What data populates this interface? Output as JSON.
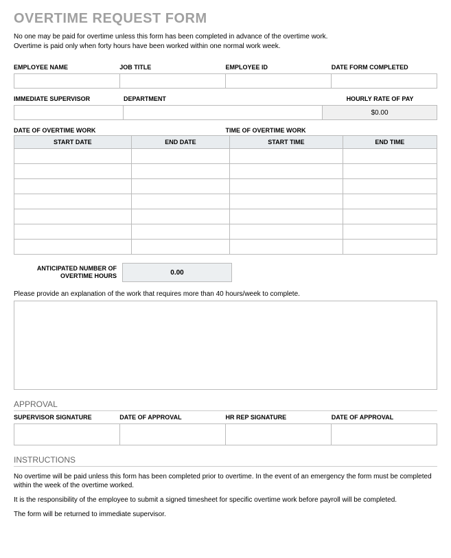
{
  "title": "OVERTIME REQUEST FORM",
  "intro_line1": "No one may be paid for overtime unless this form has been completed in advance of the overtime work.",
  "intro_line2": "Overtime is paid only when forty hours have been worked within one normal work week.",
  "labels": {
    "employee_name": "EMPLOYEE NAME",
    "job_title": "JOB TITLE",
    "employee_id": "EMPLOYEE ID",
    "date_form_completed": "DATE FORM COMPLETED",
    "immediate_supervisor": "IMMEDIATE SUPERVISOR",
    "department": "DEPARTMENT",
    "hourly_rate": "HOURLY RATE OF PAY",
    "date_of_ot": "DATE OF OVERTIME WORK",
    "time_of_ot": "TIME OF OVERTIME WORK",
    "start_date": "START DATE",
    "end_date": "END DATE",
    "start_time": "START TIME",
    "end_time": "END TIME",
    "anticipated": "ANTICIPATED NUMBER OF OVERTIME HOURS",
    "explanation": "Please provide an explanation of the work that requires more than 40 hours/week to complete.",
    "approval": "APPROVAL",
    "supervisor_sig": "SUPERVISOR SIGNATURE",
    "date_approval1": "DATE OF APPROVAL",
    "hr_sig": "HR REP SIGNATURE",
    "date_approval2": "DATE OF APPROVAL",
    "instructions": "INSTRUCTIONS"
  },
  "values": {
    "hourly_rate": "$0.00",
    "anticipated_hours": "0.00"
  },
  "instructions": {
    "p1": "No overtime will be paid unless this form has been completed prior to overtime.  In the event of an emergency the form must be completed within the week of the overtime worked.",
    "p2": "It is the responsibility of the employee to submit a signed timesheet for specific overtime work before payroll will be completed.",
    "p3": "The form will be returned to immediate supervisor."
  }
}
